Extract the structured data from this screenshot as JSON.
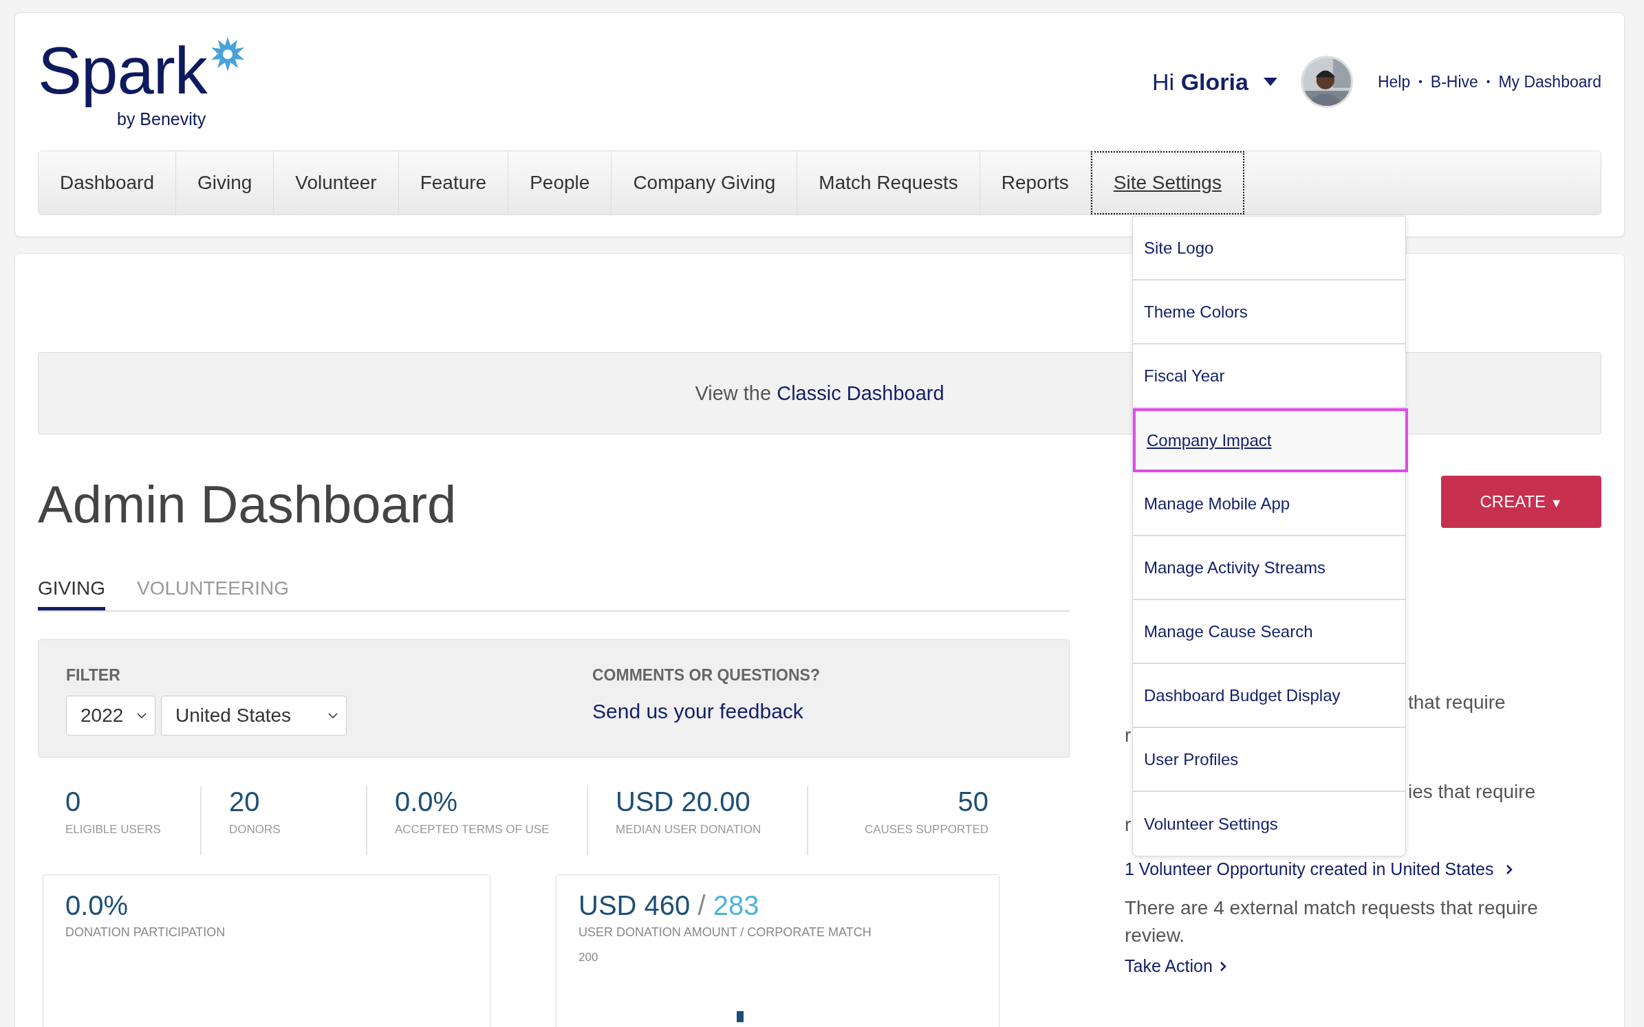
{
  "logo": {
    "wordmark": "Spark",
    "tagline": "by Benevity"
  },
  "user": {
    "greeting": "Hi",
    "name": "Gloria"
  },
  "top_links": [
    "Help",
    "B-Hive",
    "My Dashboard"
  ],
  "link_separator": "•",
  "nav": [
    {
      "label": "Dashboard",
      "selected": false
    },
    {
      "label": "Giving",
      "selected": false
    },
    {
      "label": "Volunteer",
      "selected": false
    },
    {
      "label": "Feature",
      "selected": false
    },
    {
      "label": "People",
      "selected": false
    },
    {
      "label": "Company Giving",
      "selected": false
    },
    {
      "label": "Match Requests",
      "selected": false
    },
    {
      "label": "Reports",
      "selected": false
    },
    {
      "label": "Site Settings",
      "selected": true
    }
  ],
  "site_settings_menu": [
    {
      "label": "Site Logo",
      "selected": false
    },
    {
      "label": "Theme Colors",
      "selected": false
    },
    {
      "label": "Fiscal Year",
      "selected": false
    },
    {
      "label": "Company Impact",
      "selected": true
    },
    {
      "label": "Manage Mobile App",
      "selected": false
    },
    {
      "label": "Manage Activity Streams",
      "selected": false
    },
    {
      "label": "Manage Cause Search",
      "selected": false
    },
    {
      "label": "Dashboard Budget Display",
      "selected": false
    },
    {
      "label": "User Profiles",
      "selected": false
    },
    {
      "label": "Volunteer Settings",
      "selected": false
    }
  ],
  "banner": {
    "prefix": "View the",
    "link": "Classic Dashboard"
  },
  "page_title": "Admin Dashboard",
  "create_button": {
    "label": "CREATE",
    "caret": "▼"
  },
  "tabs": [
    {
      "label": "GIVING",
      "selected": true
    },
    {
      "label": "VOLUNTEERING",
      "selected": false
    }
  ],
  "filter": {
    "label": "FILTER",
    "year": "2022",
    "country": "United States"
  },
  "feedback": {
    "label": "COMMENTS OR QUESTIONS?",
    "link": "Send us your feedback"
  },
  "stats": [
    {
      "value": "0",
      "label": "ELIGIBLE USERS"
    },
    {
      "value": "20",
      "label": "DONORS"
    },
    {
      "value": "0.0%",
      "label": "ACCEPTED TERMS OF USE"
    },
    {
      "value": "USD 20.00",
      "label": "MEDIAN USER DONATION"
    },
    {
      "value": "50",
      "label": "CAUSES SUPPORTED"
    }
  ],
  "cards": [
    {
      "kind": "percent",
      "value": "0.0%",
      "label": "DONATION PARTICIPATION"
    },
    {
      "kind": "amount",
      "value": "USD 460",
      "separator": "/",
      "secondary": "283",
      "label": "USER DONATION AMOUNT / CORPORATE MATCH",
      "axis_label": "200"
    }
  ],
  "side_panel": {
    "notices": [
      {
        "line1_end": "that require",
        "line2_start": "r"
      },
      {
        "line1_end": "ies that require",
        "line2_start": "r"
      }
    ],
    "volunteer_link": "1 Volunteer Opportunity created in United States",
    "match_notice": "There are 4 external match requests that require review.",
    "action_link": "Take Action"
  }
}
